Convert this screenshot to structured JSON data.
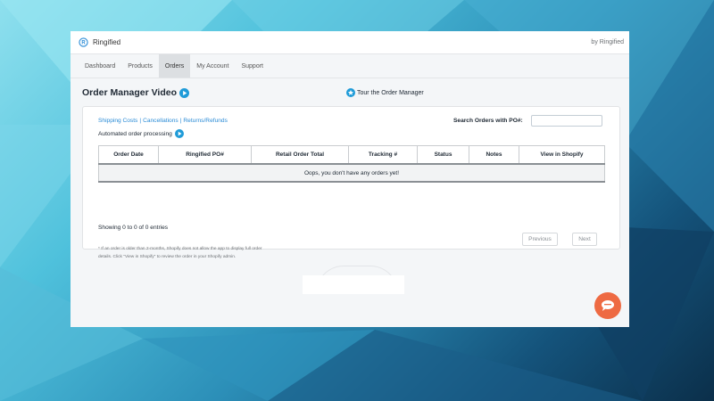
{
  "app": {
    "title": "Ringified",
    "by_label": "by Ringified"
  },
  "nav": {
    "items": [
      "Dashboard",
      "Products",
      "Orders",
      "My Account",
      "Support"
    ],
    "active": "Orders"
  },
  "page": {
    "title": "Order Manager Video",
    "tour_label": "Tour the Order Manager"
  },
  "links": {
    "shipping": "Shipping Costs",
    "cancellations": "Cancellations",
    "returns": "Returns/Refunds",
    "separator": "|"
  },
  "automated_label": "Automated order processing",
  "search": {
    "label": "Search Orders with PO#:",
    "value": "",
    "placeholder": ""
  },
  "table": {
    "columns": [
      "Order Date",
      "Ringified PO#",
      "Retail Order Total",
      "Tracking #",
      "Status",
      "Notes",
      "View in Shopify"
    ],
    "empty_message": "Oops, you don't have any orders yet!"
  },
  "showing_text": "Showing 0 to 0 of 0 entries",
  "note": "* If an order is older than 2-months, Shopify does not allow the app to display full order details. Click \"View in Shopify\" to review the order in your Shopify admin.",
  "pagination": {
    "previous": "Previous",
    "next": "Next"
  },
  "colors": {
    "accent": "#2a8bd6",
    "chat": "#ee6a43",
    "play": "#1f9bd8"
  },
  "icons": {
    "logo": "ringified-logo-icon",
    "play": "play-icon",
    "tour": "star-icon",
    "chat": "chat-icon"
  }
}
